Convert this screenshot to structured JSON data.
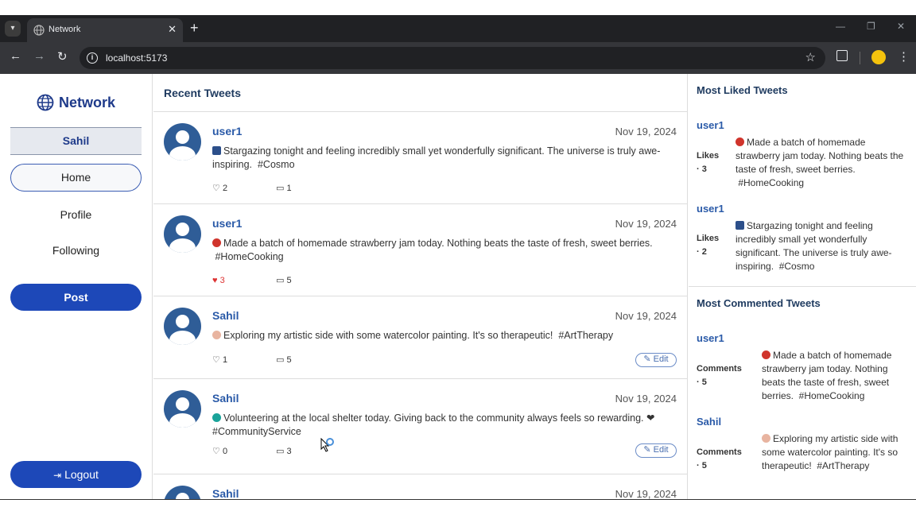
{
  "browser": {
    "tab_title": "Network",
    "url": "localhost:5173"
  },
  "sidebar": {
    "brand": "Network",
    "user": "Sahil",
    "nav": [
      "Home",
      "Profile",
      "Following"
    ],
    "post_label": "Post",
    "logout_label": "Logout"
  },
  "feed": {
    "title": "Recent Tweets",
    "tweets": [
      {
        "user": "user1",
        "date": "Nov 19, 2024",
        "text": "Stargazing tonight and feeling incredibly small yet wonderfully significant. The universe is truly awe-inspiring.  #Cosmo",
        "likes": "2",
        "comments": "1",
        "liked": false,
        "editable": false
      },
      {
        "user": "user1",
        "date": "Nov 19, 2024",
        "text": "Made a batch of homemade strawberry jam today. Nothing beats the taste of fresh, sweet berries.  #HomeCooking",
        "likes": "3",
        "comments": "5",
        "liked": true,
        "editable": false
      },
      {
        "user": "Sahil",
        "date": "Nov 19, 2024",
        "text": "Exploring my artistic side with some watercolor painting. It's so therapeutic!  #ArtTherapy",
        "likes": "1",
        "comments": "5",
        "liked": false,
        "editable": true
      },
      {
        "user": "Sahil",
        "date": "Nov 19, 2024",
        "text": "Volunteering at the local shelter today. Giving back to the community always feels so rewarding. ❤ #CommunityService",
        "likes": "0",
        "comments": "3",
        "liked": false,
        "editable": true
      },
      {
        "user": "Sahil",
        "date": "Nov 19, 2024"
      }
    ],
    "edit_label": "Edit"
  },
  "most_liked": {
    "title": "Most Liked Tweets",
    "items": [
      {
        "user": "user1",
        "meta_label": "Likes",
        "meta_value": "· 3",
        "text": "Made a batch of homemade strawberry jam today. Nothing beats the taste of fresh, sweet berries.  #HomeCooking"
      },
      {
        "user": "user1",
        "meta_label": "Likes",
        "meta_value": "· 2",
        "text": "Stargazing tonight and feeling incredibly small yet wonderfully significant. The universe is truly awe-inspiring.  #Cosmo"
      }
    ]
  },
  "most_commented": {
    "title": "Most Commented Tweets",
    "items": [
      {
        "user": "user1",
        "meta_label": "Comments",
        "meta_value": "· 5",
        "text": "Made a batch of homemade strawberry jam today. Nothing beats the taste of fresh, sweet berries.  #HomeCooking"
      },
      {
        "user": "Sahil",
        "meta_label": "Comments",
        "meta_value": "· 5",
        "text": "Exploring my artistic side with some watercolor painting. It's so therapeutic!  #ArtTherapy"
      }
    ]
  },
  "colors": {
    "accent": "#1d48b8",
    "link": "#2a5aa8",
    "heading": "#1e3a5f",
    "liked": "#d33"
  }
}
